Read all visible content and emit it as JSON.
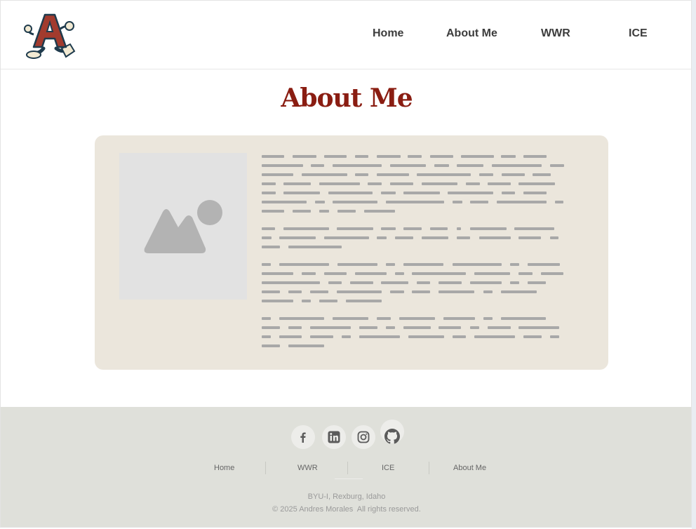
{
  "header": {
    "logo_alt": "A",
    "nav": [
      {
        "label": "Home"
      },
      {
        "label": "About Me"
      },
      {
        "label": "WWR"
      },
      {
        "label": "ICE"
      }
    ]
  },
  "main": {
    "title": "About Me"
  },
  "footer": {
    "social": [
      {
        "name": "facebook-icon"
      },
      {
        "name": "linkedin-icon"
      },
      {
        "name": "instagram-icon"
      },
      {
        "name": "github-icon"
      }
    ],
    "nav": [
      {
        "label": "Home"
      },
      {
        "label": "WWR"
      },
      {
        "label": "ICE"
      },
      {
        "label": "About Me"
      }
    ],
    "location": "BYU-I, Rexburg, Idaho",
    "copyright": "© 2025 Andres Morales  All rights reserved."
  },
  "colors": {
    "title": "#8a1d12",
    "card_bg": "#ebe6dc",
    "footer_bg": "#dfe0da",
    "logo_red": "#a23b2e",
    "logo_navy": "#1f3b4d"
  }
}
